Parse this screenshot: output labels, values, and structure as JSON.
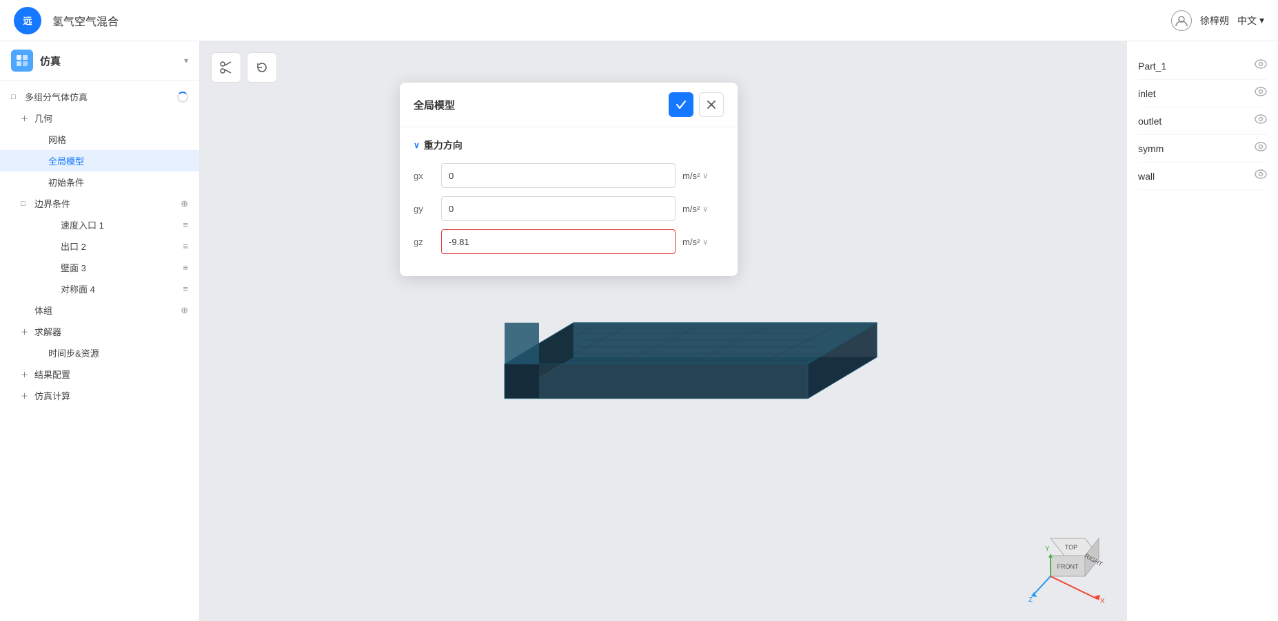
{
  "header": {
    "logo_text": "远",
    "app_name": "氢气空气混合",
    "user_name": "徐梓朔",
    "language": "中文",
    "chevron": "▾"
  },
  "sidebar": {
    "title": "仿真",
    "chevron": "▾",
    "items": [
      {
        "id": "multi-gas",
        "label": "多组分气体仿真",
        "indent": 0,
        "expand": "□",
        "has_spinner": true
      },
      {
        "id": "geometry",
        "label": "几何",
        "indent": 1,
        "expand": "＋"
      },
      {
        "id": "mesh",
        "label": "网格",
        "indent": 2
      },
      {
        "id": "global-model",
        "label": "全局模型",
        "indent": 2,
        "active": true
      },
      {
        "id": "initial-conditions",
        "label": "初始条件",
        "indent": 2
      },
      {
        "id": "boundary-conditions",
        "label": "边界条件",
        "indent": 1,
        "expand": "□",
        "has_add": true
      },
      {
        "id": "velocity-inlet-1",
        "label": "速度入口 1",
        "indent": 2,
        "has_menu": true
      },
      {
        "id": "outlet-2",
        "label": "出口 2",
        "indent": 2,
        "has_menu": true
      },
      {
        "id": "wall-3",
        "label": "壁面 3",
        "indent": 2,
        "has_menu": true
      },
      {
        "id": "symm-4",
        "label": "对称面 4",
        "indent": 2,
        "has_menu": true
      },
      {
        "id": "body-group",
        "label": "体组",
        "indent": 1,
        "has_add": true
      },
      {
        "id": "solver",
        "label": "求解器",
        "indent": 1,
        "expand": "＋"
      },
      {
        "id": "time-step",
        "label": "时间步&资源",
        "indent": 2
      },
      {
        "id": "result-config",
        "label": "结果配置",
        "indent": 1,
        "expand": "＋"
      },
      {
        "id": "sim-calc",
        "label": "仿真计算",
        "indent": 1,
        "expand": "＋"
      }
    ]
  },
  "toolbar": {
    "cut_icon": "✂",
    "reset_icon": "↺"
  },
  "dialog": {
    "title": "全局模型",
    "confirm_icon": "✓",
    "close_icon": "✕",
    "section_label": "重力方向",
    "section_toggle": "∨",
    "fields": [
      {
        "id": "gx",
        "label": "gx",
        "value": "0",
        "unit": "m/s²",
        "highlighted": false
      },
      {
        "id": "gy",
        "label": "gy",
        "value": "0",
        "unit": "m/s²",
        "highlighted": false
      },
      {
        "id": "gz",
        "label": "gz",
        "value": "-9.81",
        "unit": "m/s²",
        "highlighted": true
      }
    ]
  },
  "right_panel": {
    "items": [
      {
        "id": "part1",
        "label": "Part_1"
      },
      {
        "id": "inlet",
        "label": "inlet"
      },
      {
        "id": "outlet",
        "label": "outlet"
      },
      {
        "id": "symm",
        "label": "symm"
      },
      {
        "id": "wall",
        "label": "wall"
      }
    ],
    "eye_icon": "👁"
  },
  "axis": {
    "top_label": "TOP",
    "front_label": "FRONT",
    "right_label": "RIGHT",
    "y_color": "#4CAF50",
    "z_color": "#2196F3",
    "x_color": "#f44336"
  }
}
